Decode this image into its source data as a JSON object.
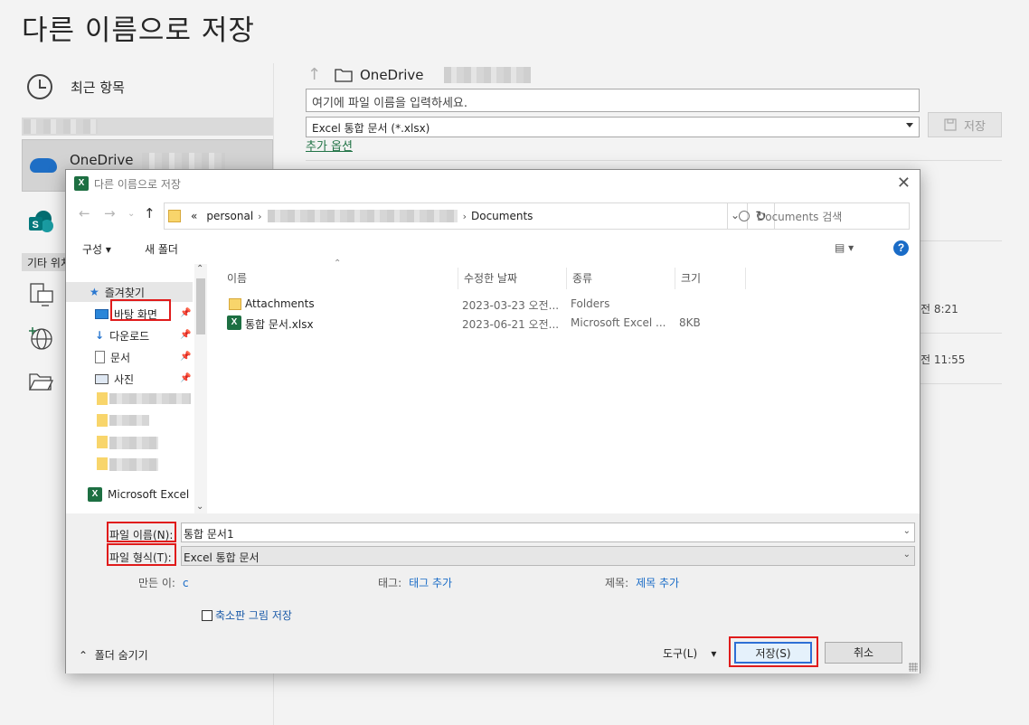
{
  "backstage": {
    "title": "다른 이름으로 저장",
    "recent_label": "최근 항목",
    "onedrive_label": "OneDrive",
    "other_locations_label": "기타 위치",
    "nav_location": "OneDrive",
    "filename_placeholder": "여기에 파일 이름을 입력하세요.",
    "filetype_value": "Excel 통합 문서 (*.xlsx)",
    "save_label": "저장",
    "more_options_label": "추가 옵션",
    "times": [
      "전 8:21",
      "전 11:55"
    ]
  },
  "dialog": {
    "title": "다른 이름으로 저장",
    "address": {
      "prefix": "«",
      "seg1": "personal",
      "sep": "›",
      "seg_last": "Documents"
    },
    "search_placeholder": "Documents 검색",
    "toolbar": {
      "organize": "구성 ▾",
      "new_folder": "새 폴더"
    },
    "nav": {
      "favorites": "즐겨찾기",
      "items": [
        "바탕 화면",
        "다운로드",
        "문서",
        "사진"
      ],
      "excel": "Microsoft Excel"
    },
    "columns": [
      "이름",
      "수정한 날짜",
      "종류",
      "크기"
    ],
    "files": [
      {
        "name": "Attachments",
        "date": "2023-03-23 오전...",
        "type": "Folders",
        "size": ""
      },
      {
        "name": "통합 문서.xlsx",
        "date": "2023-06-21 오전...",
        "type": "Microsoft Excel ...",
        "size": "8KB"
      }
    ],
    "filename_label": "파일 이름(N):",
    "filename_value": "통합 문서1",
    "filetype_label": "파일 형식(T):",
    "filetype_value": "Excel 통합 문서",
    "meta": {
      "author_key": "만든 이:",
      "author_val": "c",
      "tags_key": "태그:",
      "tags_val": "태그 추가",
      "title_key": "제목:",
      "title_val": "제목 추가"
    },
    "thumbnail_label": "축소판 그림 저장",
    "hide_folders_label": "폴더 숨기기",
    "tools_label": "도구(L)",
    "save_label": "저장(S)",
    "cancel_label": "취소"
  }
}
